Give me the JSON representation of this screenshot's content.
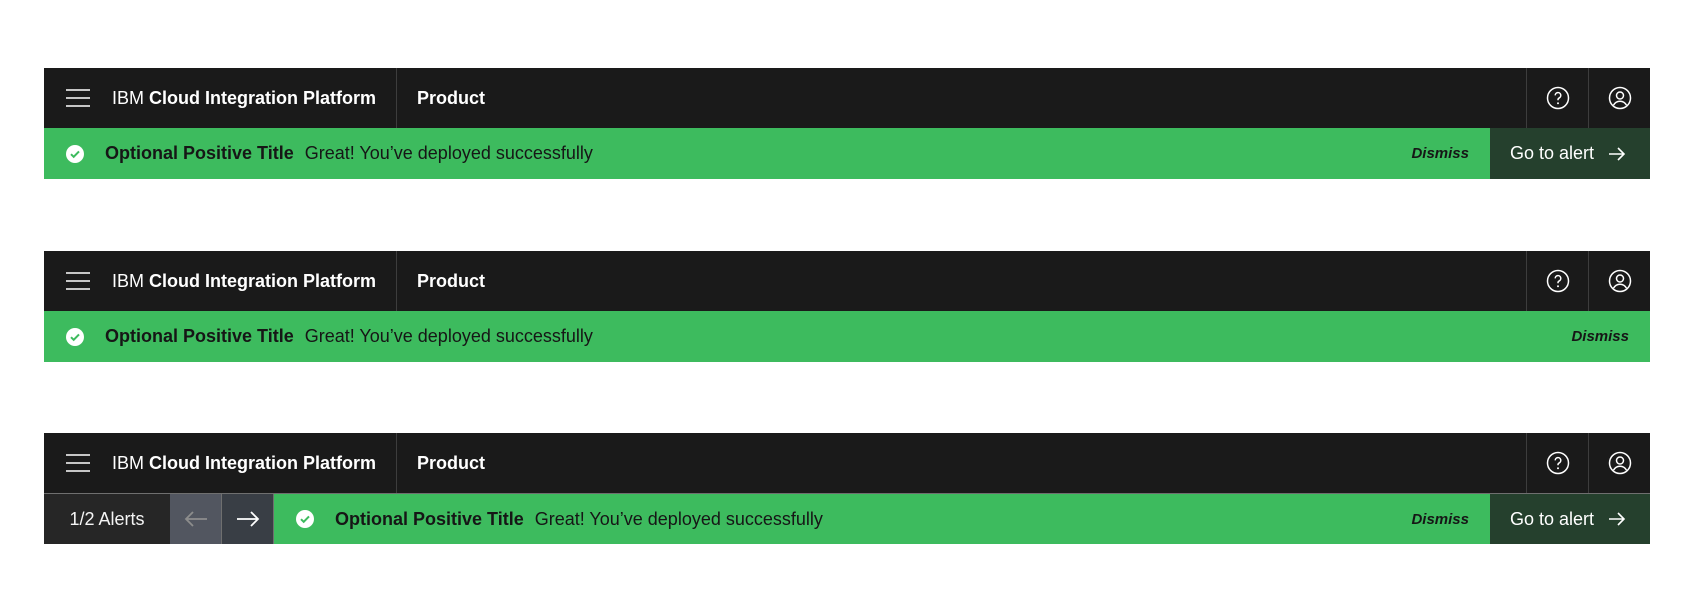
{
  "header": {
    "brand_prefix": "IBM",
    "brand_name": "Cloud Integration Platform",
    "product": "Product",
    "icons": [
      "menu-icon",
      "help-icon",
      "user-icon"
    ]
  },
  "alert": {
    "title": "Optional Positive Title",
    "message": "Great! You’ve deployed successfully",
    "dismiss": "Dismiss",
    "goto": "Go to alert",
    "icon": "checkmark-icon"
  },
  "pager": {
    "counter": "1/2 Alerts",
    "icons": [
      "arrow-left-icon",
      "arrow-right-icon"
    ]
  },
  "colors": {
    "header_bg": "#1a1a1a",
    "alert_bg": "#3dbb5e",
    "goto_bg": "#25402d",
    "counter_bg": "#262626"
  }
}
